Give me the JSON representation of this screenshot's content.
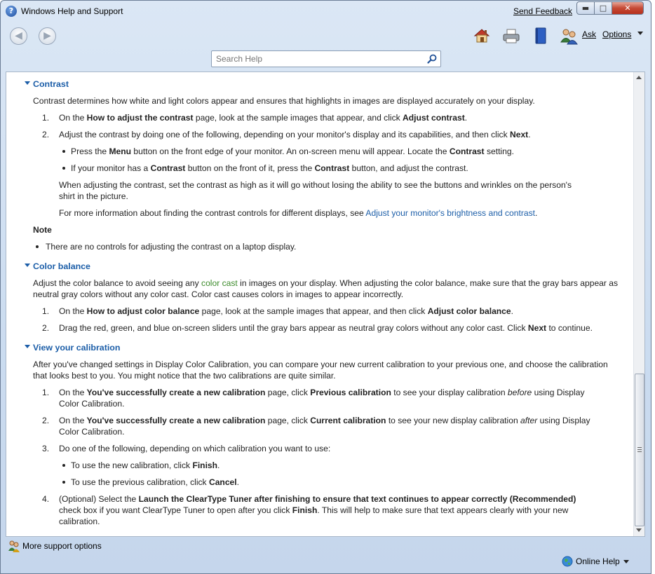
{
  "window": {
    "title": "Windows Help and Support",
    "send_feedback": "Send Feedback",
    "min_glyph": "▬",
    "max_glyph": "□",
    "close_glyph": "✕"
  },
  "toolbar": {
    "back_glyph": "◀",
    "forward_glyph": "▶",
    "ask_label": "Ask",
    "options_label": "Options"
  },
  "search": {
    "placeholder": "Search Help"
  },
  "article": {
    "contrast": {
      "heading": "Contrast",
      "intro": "Contrast determines how white and light colors appear and ensures that highlights in images are displayed accurately on your display.",
      "step1_num": "1.",
      "step1_a": "On the ",
      "step1_b": "How to adjust the contrast",
      "step1_c": " page, look at the sample images that appear, and click ",
      "step1_d": "Adjust contrast",
      "step1_e": ".",
      "step2_num": "2.",
      "step2_a": "Adjust the contrast by doing one of the following, depending on your monitor's display and its capabilities, and then click ",
      "step2_b": "Next",
      "step2_c": ".",
      "b1_a": "Press the ",
      "b1_b": "Menu",
      "b1_c": " button on the front edge of your monitor. An on-screen menu will appear. Locate the ",
      "b1_d": "Contrast",
      "b1_e": " setting.",
      "b2_a": "If your monitor has a ",
      "b2_b": "Contrast",
      "b2_c": " button on the front of it, press the ",
      "b2_d": "Contrast",
      "b2_e": " button, and adjust the contrast.",
      "p1_line1": "When adjusting the contrast, set the contrast as high as it will go without losing the ability to see the buttons and wrinkles on the person's",
      "p1_line2": "shirt in the picture.",
      "p2_a": "For more information about finding the contrast controls for different displays, see ",
      "p2_link": "Adjust your monitor's brightness and contrast",
      "p2_b": ".",
      "note_heading": "Note",
      "note_text": "There are no controls for adjusting the contrast on a laptop display."
    },
    "color_balance": {
      "heading": "Color balance",
      "intro1_a": "Adjust the color balance to avoid seeing any ",
      "intro1_link": "color cast",
      "intro1_b": " in images on your display. When adjusting the color balance, make sure that the gray bars appear as",
      "intro2": "neutral gray colors without any color cast. Color cast causes colors in images to appear incorrectly.",
      "step1_num": "1.",
      "step1_a": "On the ",
      "step1_b": "How to adjust color balance",
      "step1_c": " page, look at the sample images that appear, and then click ",
      "step1_d": "Adjust color balance",
      "step1_e": ".",
      "step2_num": "2.",
      "step2_a": "Drag the red, green, and blue on-screen sliders until the gray bars appear as neutral gray colors without any color cast. Click ",
      "step2_b": "Next",
      "step2_c": " to continue."
    },
    "calibration": {
      "heading": "View your calibration",
      "intro1": "After you've changed settings in Display Color Calibration, you can compare your new current calibration to your previous one, and choose the calibration",
      "intro2": "that looks best to you. You might notice that the two calibrations are quite similar.",
      "step1_num": "1.",
      "step1_a": "On the ",
      "step1_b": "You've successfully create a new calibration",
      "step1_c": " page, click ",
      "step1_d": "Previous calibration",
      "step1_e": " to see your display calibration ",
      "step1_f": "before",
      "step1_g": " using Display",
      "step1_line2": "Color Calibration.",
      "step2_num": "2.",
      "step2_a": "On the ",
      "step2_b": "You've successfully create a new calibration",
      "step2_c": " page, click ",
      "step2_d": "Current calibration",
      "step2_e": " to see your new display calibration ",
      "step2_f": "after",
      "step2_g": " using Display",
      "step2_line2": "Color Calibration.",
      "step3_num": "3.",
      "step3": "Do one of the following, depending on which calibration you want to use:",
      "b1_a": "To use the new calibration, click ",
      "b1_b": "Finish",
      "b1_c": ".",
      "b2_a": "To use the previous calibration, click ",
      "b2_b": "Cancel",
      "b2_c": ".",
      "step4_num": "4.",
      "step4_a": "(Optional) Select the ",
      "step4_b": "Launch the ClearType Tuner after finishing to ensure that text continues to appear correctly (Recommended)",
      "step4_l2_a": "check box if you want ClearType Tuner to open after you click ",
      "step4_l2_b": "Finish",
      "step4_l2_c": ". This will help to make sure that text appears clearly with your new",
      "step4_l3": "calibration."
    }
  },
  "status": {
    "more_support": "More support options",
    "online_help": "Online Help"
  },
  "colors": {
    "link": "#1c5ea8",
    "color_cast_link": "#3c8b2b"
  },
  "icons": [
    "help-icon",
    "back-arrow-icon",
    "forward-arrow-icon",
    "home-icon",
    "print-icon",
    "browse-help-icon",
    "ask-icon",
    "search-icon",
    "more-support-icon",
    "globe-icon"
  ]
}
